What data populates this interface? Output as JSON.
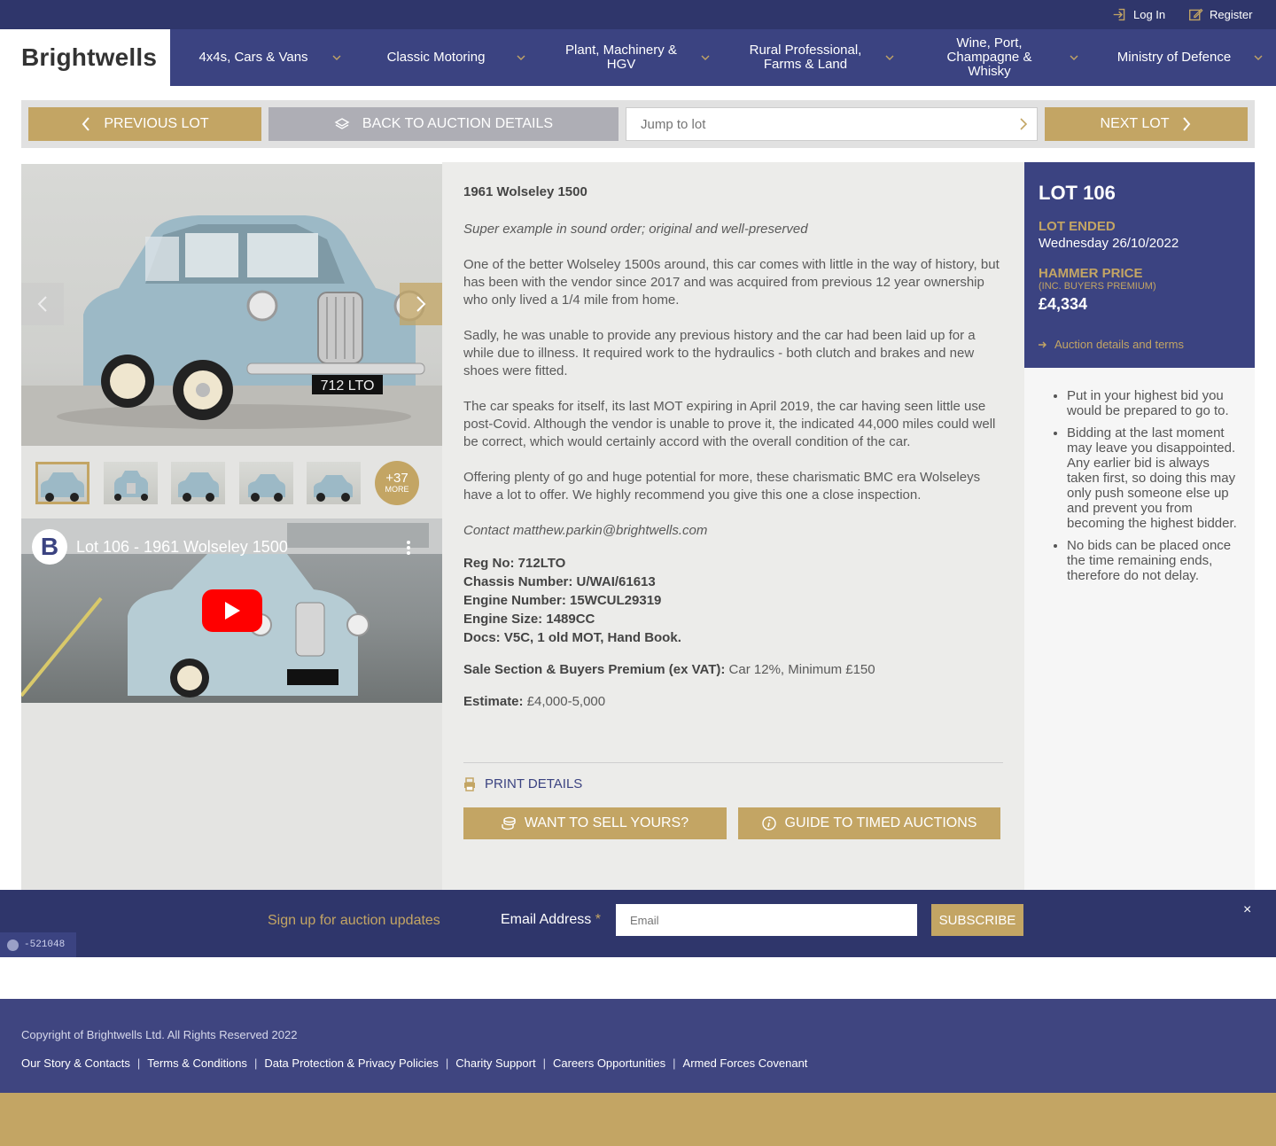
{
  "topbar": {
    "login": "Log In",
    "register": "Register"
  },
  "brand": {
    "logo_text": "Brightwells"
  },
  "nav": {
    "items": [
      {
        "label": "4x4s, Cars & Vans"
      },
      {
        "label": "Classic Motoring"
      },
      {
        "label": "Plant, Machinery & HGV"
      },
      {
        "label": "Rural Professional, Farms & Land"
      },
      {
        "label": "Wine, Port, Champagne & Whisky"
      },
      {
        "label": "Ministry of Defence"
      }
    ]
  },
  "lotnav": {
    "previous": "Previous Lot",
    "back": "Back to Auction Details",
    "jump_placeholder": "Jump to lot",
    "next": "Next Lot"
  },
  "gallery": {
    "more_count": "+37",
    "more_label": "MORE",
    "video_title": "Lot 106 - 1961 Wolseley 1500",
    "plate": "712 LTO"
  },
  "lot": {
    "title": "1961 Wolseley 1500",
    "subtitle": "Super example in sound order; original and well-preserved",
    "paragraphs": [
      "One of the better Wolseley 1500s around, this car comes with little in the way of history, but has been with the vendor since 2017 and was acquired from previous 12 year ownership who only lived a 1/4 mile from home.",
      "Sadly, he was unable to provide any previous history and the car had been laid up for a while due to illness. It required work to the hydraulics - both clutch and brakes and new shoes were fitted.",
      "The car speaks for itself, its last MOT expiring in April 2019, the car having seen little use post-Covid. Although the vendor is unable to prove it, the indicated 44,000 miles could well be correct, which would certainly accord with the overall condition of the car.",
      "Offering plenty of go and huge potential for more, these charismatic BMC era Wolseleys have a lot to offer. We highly recommend you give this one a close inspection."
    ],
    "contact": "Contact matthew.parkin@brightwells.com",
    "specs": [
      "Reg No: 712LTO",
      "Chassis Number: U/WAI/61613",
      "Engine Number: 15WCUL29319",
      "Engine Size: 1489CC",
      "Docs: V5C, 1 old MOT, Hand Book."
    ],
    "sale_label": "Sale Section & Buyers Premium (ex VAT):",
    "sale_value": "Car 12%, Minimum £150",
    "estimate_label": "Estimate:",
    "estimate_value": "£4,000-5,000",
    "print": "PRINT DETAILS",
    "sell_button": "Want to sell yours?",
    "guide_button": "Guide to timed auctions"
  },
  "lotbox": {
    "lot_number": "LOT 106",
    "status": "LOT ENDED",
    "ended_date": "Wednesday 26/10/2022",
    "hammer_label": "HAMMER PRICE",
    "hammer_sub": "(INC. BUYERS PREMIUM)",
    "hammer_price": "£4,334",
    "auction_link": "Auction details and terms"
  },
  "tips": [
    "Put in your highest bid you would be prepared to go to.",
    "Bidding at the last moment may leave you disappointed. Any earlier bid is always taken first, so doing this may only push someone else up and prevent you from becoming the highest bidder.",
    "No bids can be placed once the time remaining ends, therefore do not delay."
  ],
  "newsletter": {
    "label": "Sign up for auction updates",
    "email_label": "Email Address",
    "required_mark": "*",
    "email_placeholder": "Email",
    "subscribe": "Subscribe",
    "close": "×"
  },
  "debug": {
    "text": "-521048"
  },
  "footer": {
    "copyright": "Copyright of Brightwells Ltd. All Rights Reserved 2022",
    "links": [
      "Our Story & Contacts",
      "Terms & Conditions",
      "Data Protection & Privacy Policies",
      "Charity Support",
      "Careers Opportunities",
      "Armed Forces Covenant"
    ],
    "separator": "|"
  },
  "colors": {
    "navy": "#2f366b",
    "nav_blue": "#3b4381",
    "gold": "#c3a564",
    "grey_button": "#aeaeb5"
  }
}
